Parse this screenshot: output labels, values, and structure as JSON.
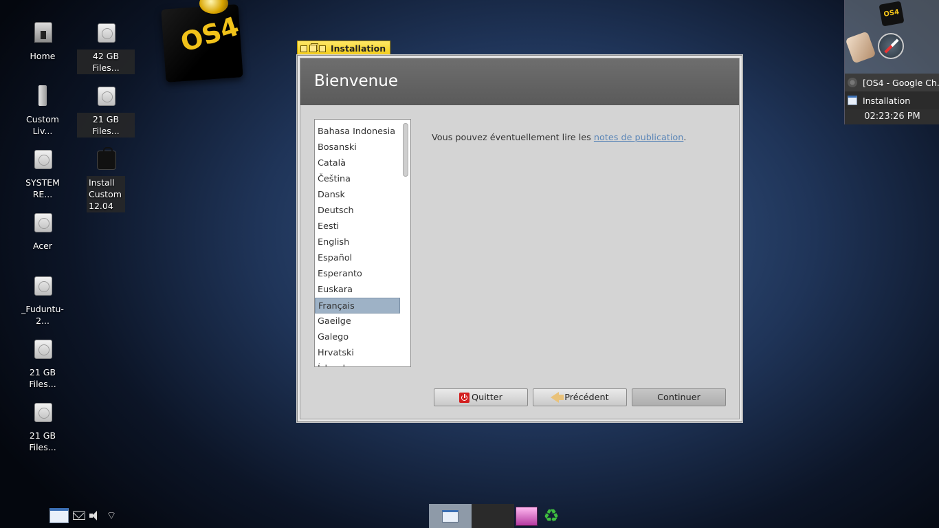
{
  "desktop": {
    "icons": [
      {
        "label": "Home"
      },
      {
        "label": "42 GB Files..."
      },
      {
        "label": "Custom Liv..."
      },
      {
        "label": "21 GB Files..."
      },
      {
        "label": "SYSTEM RE..."
      },
      {
        "label": "Install Custom 12.04"
      },
      {
        "label": "Acer"
      },
      {
        "label": "_Fuduntu-2..."
      },
      {
        "label": "21 GB Files..."
      },
      {
        "label": "21 GB Files..."
      }
    ],
    "logo_text": "OS4"
  },
  "window": {
    "tab_title": "Installation",
    "header_title": "Bienvenue",
    "languages": [
      "Bahasa Indonesia",
      "Bosanski",
      "Català",
      "Čeština",
      "Dansk",
      "Deutsch",
      "Eesti",
      "English",
      "Español",
      "Esperanto",
      "Euskara",
      "Français",
      "Gaeilge",
      "Galego",
      "Hrvatski",
      "Íslenska"
    ],
    "selected_language": "Français",
    "release_prefix": "Vous pouvez éventuellement lire les ",
    "release_link": "notes de publication",
    "release_suffix": ".",
    "buttons": {
      "quit": "Quitter",
      "back": "Précédent",
      "continue": "Continuer"
    }
  },
  "panel": {
    "logo_text": "OS4",
    "tasks": [
      {
        "label": "[OS4 - Google Ch...",
        "icon": "chrome-icon"
      },
      {
        "label": "Installation",
        "icon": "window-icon"
      }
    ],
    "clock": "02:23:26 PM"
  },
  "colors": {
    "tab_yellow": "#f2cb16",
    "selection": "#9eb2c6",
    "link": "#5b86b7",
    "quit_red": "#d32020"
  }
}
